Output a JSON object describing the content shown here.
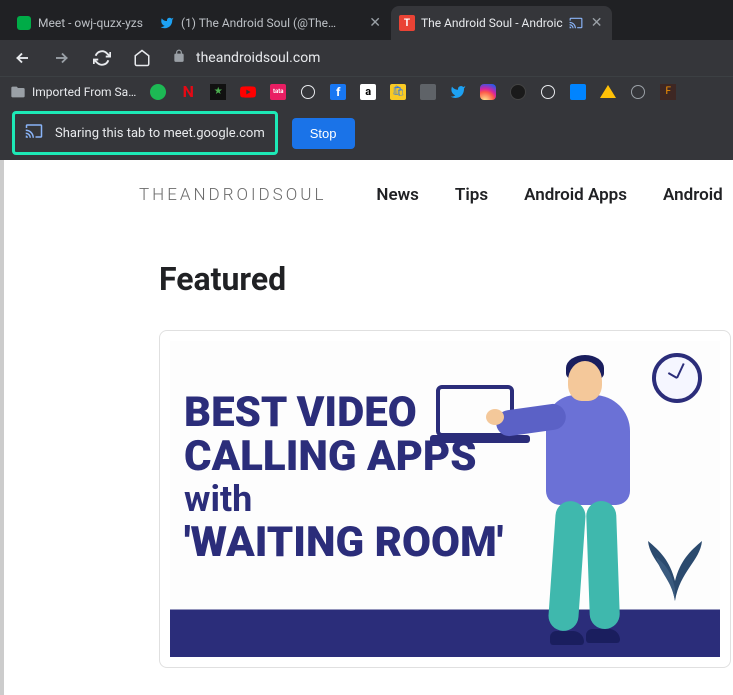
{
  "tabs": [
    {
      "label": "Meet - owj-quzx-yzs",
      "favicon": "meet"
    },
    {
      "label": "(1) The Android Soul (@TheAn",
      "favicon": "twitter"
    },
    {
      "label": "The Android Soul - Androic",
      "favicon": "tas",
      "active": true
    }
  ],
  "address": {
    "domain": "theandroidsoul.com"
  },
  "bookmarks": {
    "folder": "Imported From Sa…"
  },
  "sharing": {
    "text": "Sharing this tab to meet.google.com",
    "stop": "Stop"
  },
  "site": {
    "logo": "THEANDROIDSOUL",
    "nav": [
      "News",
      "Tips",
      "Android Apps",
      "Android"
    ]
  },
  "featured": {
    "heading": "Featured",
    "card": {
      "line1": "BEST VIDEO",
      "line2": "CALLING APPS",
      "line3": "with",
      "line4": "'WAITING ROOM'"
    }
  }
}
